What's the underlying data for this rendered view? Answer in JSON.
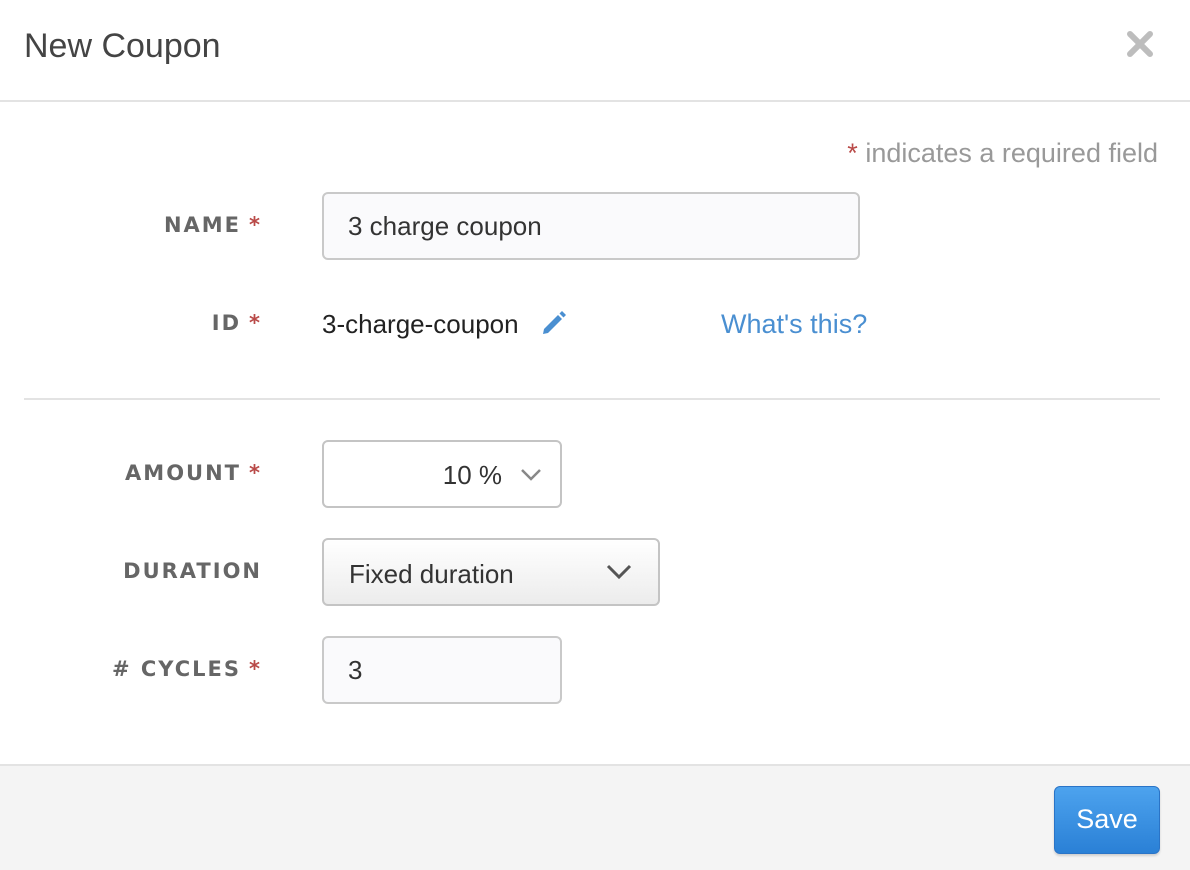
{
  "dialog": {
    "title": "New Coupon",
    "close_icon": "close-icon"
  },
  "required_note": {
    "star": "*",
    "text": " indicates a required field"
  },
  "fields": {
    "name": {
      "label": "NAME",
      "star": "*",
      "value": "3 charge coupon"
    },
    "id": {
      "label": "ID",
      "star": "*",
      "value": "3-charge-coupon",
      "edit_icon": "pencil-icon",
      "help_link": "What's this?"
    },
    "amount": {
      "label": "AMOUNT",
      "star": "*",
      "value": "10 %"
    },
    "duration": {
      "label": "DURATION",
      "value": "Fixed duration"
    },
    "cycles": {
      "label": "# CYCLES",
      "star": "*",
      "value": "3"
    }
  },
  "footer": {
    "save_label": "Save"
  },
  "colors": {
    "required_star": "#b94a48",
    "link": "#4a8fd1",
    "primary_button": "#2a80d6"
  }
}
